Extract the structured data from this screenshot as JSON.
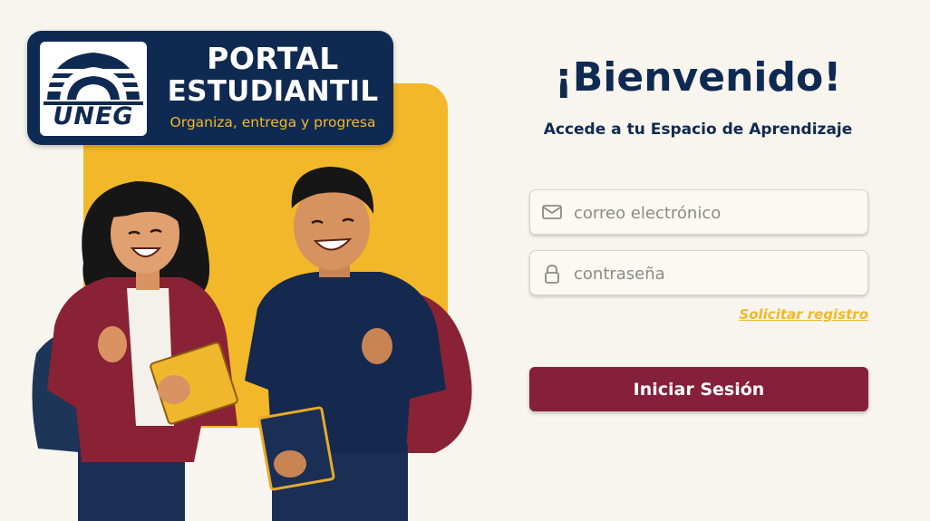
{
  "brand": {
    "logo_text": "UNEG",
    "title_line1": "PORTAL",
    "title_line2": "ESTUDIANTIL",
    "tagline": "Organiza, entrega y progresa"
  },
  "login": {
    "welcome": "¡Bienvenido!",
    "subtitle": "Accede a tu Espacio de Aprendizaje",
    "email_placeholder": "correo electrónico",
    "email_value": "",
    "password_placeholder": "contraseña",
    "password_value": "",
    "register_link": "Solicitar registro",
    "submit_label": "Iniciar Sesión"
  },
  "icons": {
    "email": "mail-icon",
    "password": "lock-icon"
  },
  "colors": {
    "navy": "#0f2a52",
    "yellow": "#f2b829",
    "maroon": "#861f3a",
    "background": "#f8f5ee"
  }
}
